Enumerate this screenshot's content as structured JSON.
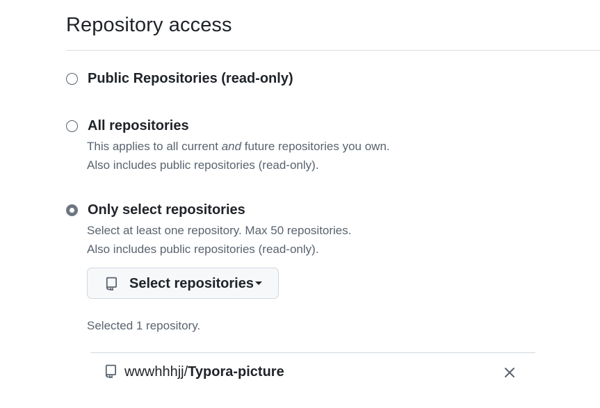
{
  "section": {
    "title": "Repository access"
  },
  "options": [
    {
      "label": "Public Repositories (read-only)",
      "checked": false
    },
    {
      "label": "All repositories",
      "checked": false,
      "note_line1_prefix": "This applies to all current ",
      "note_line1_emphasis": "and",
      "note_line1_suffix": " future repositories you own.",
      "note_line2": "Also includes public repositories (read-only)."
    },
    {
      "label": "Only select repositories",
      "checked": true,
      "note_line1": "Select at least one repository. Max 50 repositories.",
      "note_line2": "Also includes public repositories (read-only)."
    }
  ],
  "select_button": {
    "label": "Select repositories",
    "icon": "repo-icon"
  },
  "selection": {
    "count_text": "Selected 1 repository.",
    "repositories": [
      {
        "owner": "wwwhhhjj/",
        "name": "Typora-picture",
        "icon": "repo-icon",
        "remove_icon": "close-icon"
      }
    ]
  },
  "colors": {
    "text": "#1f2328",
    "muted": "#59636e",
    "border": "#d0d7de",
    "button_bg": "#f6f8fa"
  }
}
